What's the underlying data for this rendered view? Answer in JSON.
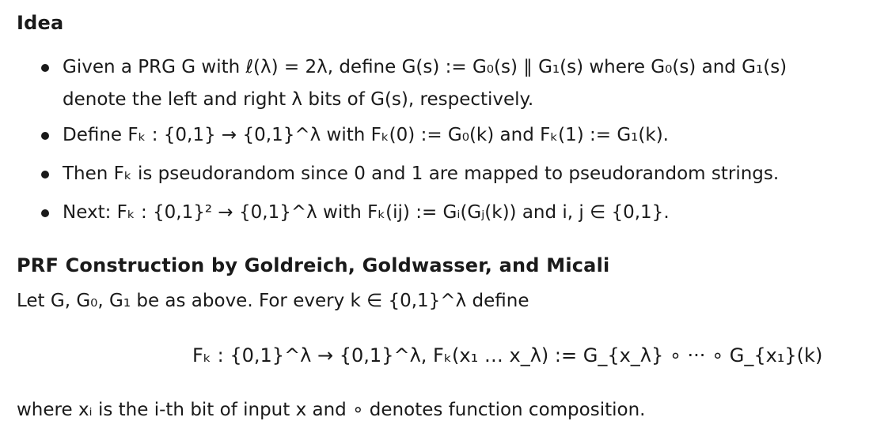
{
  "idea_section": {
    "title": "Idea",
    "bullets": [
      {
        "line1": "Given a PRG G with ℓ(λ) = 2λ, define G(s) := G₀(s) ∥ G₁(s) where G₀(s) and G₁(s)",
        "line2": "denote the left and right λ bits of G(s), respectively."
      },
      {
        "line1": "Define Fₖ : {0,1} → {0,1}^λ with Fₖ(0) := G₀(k) and Fₖ(1) := G₁(k)."
      },
      {
        "line1": "Then Fₖ is pseudorandom since 0 and 1 are mapped to pseudorandom strings."
      },
      {
        "line1": "Next: Fₖ : {0,1}² → {0,1}^λ with Fₖ(ij) := Gᵢ(Gⱼ(k)) and i, j ∈ {0,1}."
      }
    ]
  },
  "construction_section": {
    "title": "PRF Construction by Goldreich, Goldwasser, and Micali",
    "intro": "Let G, G₀, G₁ be as above. For every k ∈ {0,1}^λ define",
    "formula": "Fₖ : {0,1}^λ → {0,1}^λ,  Fₖ(x₁ … x_λ) := G_{x_λ} ∘ ··· ∘ G_{x₁}(k)",
    "footer": "where xᵢ is the i-th bit of input x and ∘ denotes function composition."
  }
}
